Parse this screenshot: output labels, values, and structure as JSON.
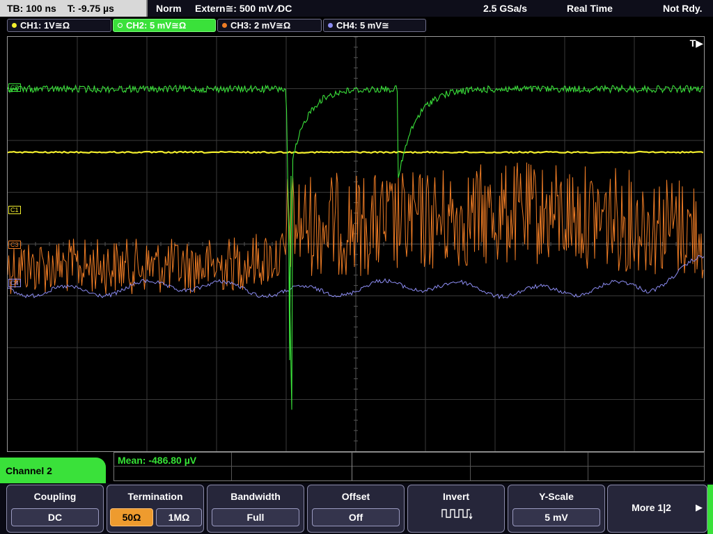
{
  "topbar": {
    "timebase": "TB: 100 ns",
    "trigger_time": "T: -9.75 µs",
    "mode": "Norm",
    "trigger_source": "Extern≅: 500 mV ⁄DC",
    "sample_rate": "2.5 GSa/s",
    "acq_mode": "Real Time",
    "status": "Not Rdy."
  },
  "channels": [
    {
      "label": "CH1: 1V≅Ω",
      "color": "#f3ef2e"
    },
    {
      "label": "CH2: 5 mV≅Ω",
      "color": "#3ae13a"
    },
    {
      "label": "CH3: 2 mV≅Ω",
      "color": "#ee7c25"
    },
    {
      "label": "CH4: 5 mV≅",
      "color": "#8c8cf2"
    }
  ],
  "screen": {
    "trigger_marker": "T▶",
    "ch_markers": {
      "c1": "C1",
      "c2": "C2",
      "c3": "C3",
      "c4": "C4"
    }
  },
  "measurement": {
    "label": "Mean: -486.80 µV"
  },
  "panel": {
    "title": "Channel 2"
  },
  "softkeys": {
    "coupling": {
      "title": "Coupling",
      "value": "DC"
    },
    "termination": {
      "title": "Termination",
      "opt1": "50Ω",
      "opt2": "1MΩ"
    },
    "bandwidth": {
      "title": "Bandwidth",
      "value": "Full"
    },
    "offset": {
      "title": "Offset",
      "value": "Off"
    },
    "invert": {
      "title": "Invert"
    },
    "yscale": {
      "title": "Y-Scale",
      "value": "5 mV"
    },
    "more": {
      "label": "More 1|2",
      "arrow": "▶"
    }
  },
  "colors": {
    "ch1": "#f3ef2e",
    "ch2": "#3ae13a",
    "ch3": "#ee7c25",
    "ch4": "#8c8cf2",
    "grid": "#3a3a3a"
  }
}
